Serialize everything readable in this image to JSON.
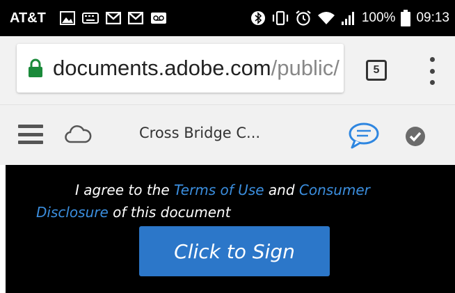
{
  "status_bar": {
    "carrier": "AT&T",
    "battery": "100%",
    "time": "09:13",
    "icons": [
      "gallery-icon",
      "keyboard-icon",
      "gmail-icon",
      "gmail-icon",
      "voicemail-icon",
      "bluetooth-icon",
      "vibrate-icon",
      "alarm-icon",
      "wifi-icon",
      "signal-icon",
      "battery-icon"
    ]
  },
  "browser": {
    "url_host": "documents.adobe.com",
    "url_path": "/public/",
    "tab_count": "5",
    "colors": {
      "lock": "#1a8a3a"
    }
  },
  "toolbar": {
    "doc_title": "Cross Bridge C...",
    "colors": {
      "comment": "#2e86e0",
      "check": "#6b6b6b"
    }
  },
  "document": {
    "agree_prefix": "I agree to the ",
    "terms_link": "Terms of Use",
    "and_text": " and ",
    "disclosure_link": "Consumer Disclosure",
    "agree_suffix": " of this document",
    "sign_label": "Click to Sign",
    "colors": {
      "link": "#3b8ede",
      "button": "#2c77c9"
    }
  }
}
